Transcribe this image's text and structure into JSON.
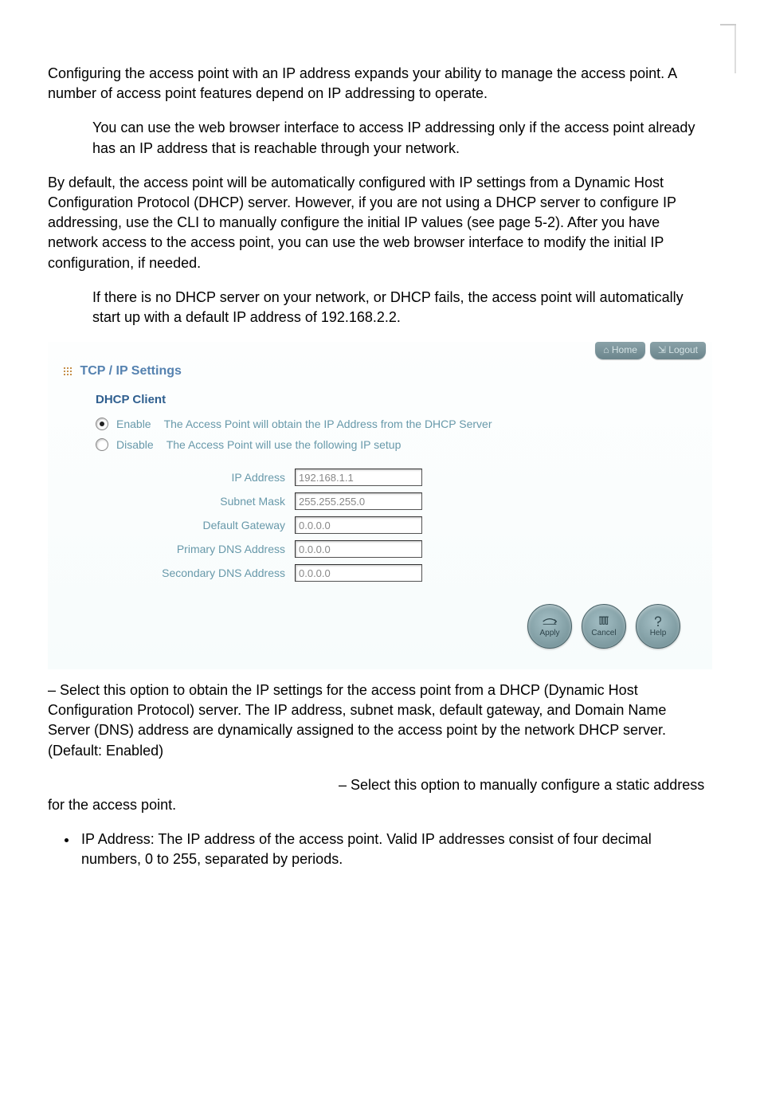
{
  "paragraphs": {
    "p1": "Configuring the access point with an IP address expands your ability to manage the access point. A number of access point features depend on IP addressing to operate.",
    "p2": "You can use the web browser interface to access IP addressing only if the access point already has an IP address that is reachable through your network.",
    "p3": "By default, the access point will be automatically configured with IP settings from a Dynamic Host Configuration Protocol (DHCP) server. However, if you are not using a DHCP server to configure IP addressing, use the CLI to manually configure the initial IP values (see page 5-2). After you have network access to the access point, you can use the web browser interface to modify the initial IP configuration, if needed.",
    "p4": "If there is no DHCP server on your network, or DHCP fails, the access point will automatically start up with a default IP address of 192.168.2.2.",
    "p5": " – Select this option to obtain the IP settings for the access point from a DHCP (Dynamic Host Configuration Protocol) server. The IP address, subnet mask, default gateway, and Domain Name Server (DNS) address are dynamically assigned to the access point by the network DHCP server. (Default: Enabled)",
    "p6": " – Select this option to manually configure a static address for the access point.",
    "bullet1": "IP Address: The IP address of the access point. Valid IP addresses consist of four decimal numbers, 0 to 255, separated by periods."
  },
  "panel": {
    "home_label": "Home",
    "logout_label": "Logout",
    "title": "TCP / IP Settings",
    "subtitle": "DHCP Client",
    "radio_enable_label": "Enable",
    "radio_enable_desc": "The Access Point  will obtain the IP Address from the DHCP Server",
    "radio_disable_label": "Disable",
    "radio_disable_desc": "The Access Point will use the following IP setup",
    "fields": [
      {
        "label": "IP Address",
        "value": "192.168.1.1"
      },
      {
        "label": "Subnet Mask",
        "value": "255.255.255.0"
      },
      {
        "label": "Default Gateway",
        "value": "0.0.0.0"
      },
      {
        "label": "Primary DNS Address",
        "value": "0.0.0.0"
      },
      {
        "label": "Secondary DNS Address",
        "value": "0.0.0.0"
      }
    ],
    "buttons": {
      "apply": "Apply",
      "cancel": "Cancel",
      "help": "Help"
    }
  }
}
